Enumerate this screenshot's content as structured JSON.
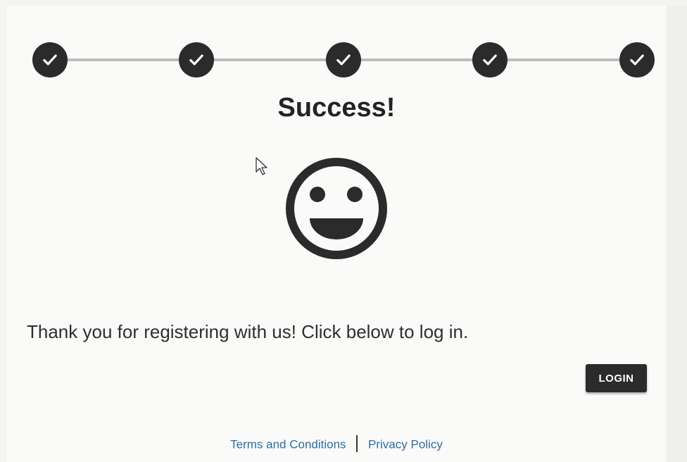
{
  "steps": [
    {
      "state": "complete",
      "icon": "check-icon"
    },
    {
      "state": "complete",
      "icon": "check-icon"
    },
    {
      "state": "complete",
      "icon": "check-icon"
    },
    {
      "state": "complete",
      "icon": "check-icon"
    },
    {
      "state": "complete",
      "icon": "check-icon"
    }
  ],
  "main": {
    "title": "Success!",
    "illustration": "smiley-face-icon",
    "message": "Thank you for registering with us! Click below to log in.",
    "login_label": "LOGIN"
  },
  "footer": {
    "terms_label": "Terms and Conditions",
    "privacy_label": "Privacy Policy"
  },
  "colors": {
    "primary": "#2b2b2b",
    "background": "#fafaf9",
    "link": "#2b6ea3",
    "connector": "#bdbdbd"
  }
}
